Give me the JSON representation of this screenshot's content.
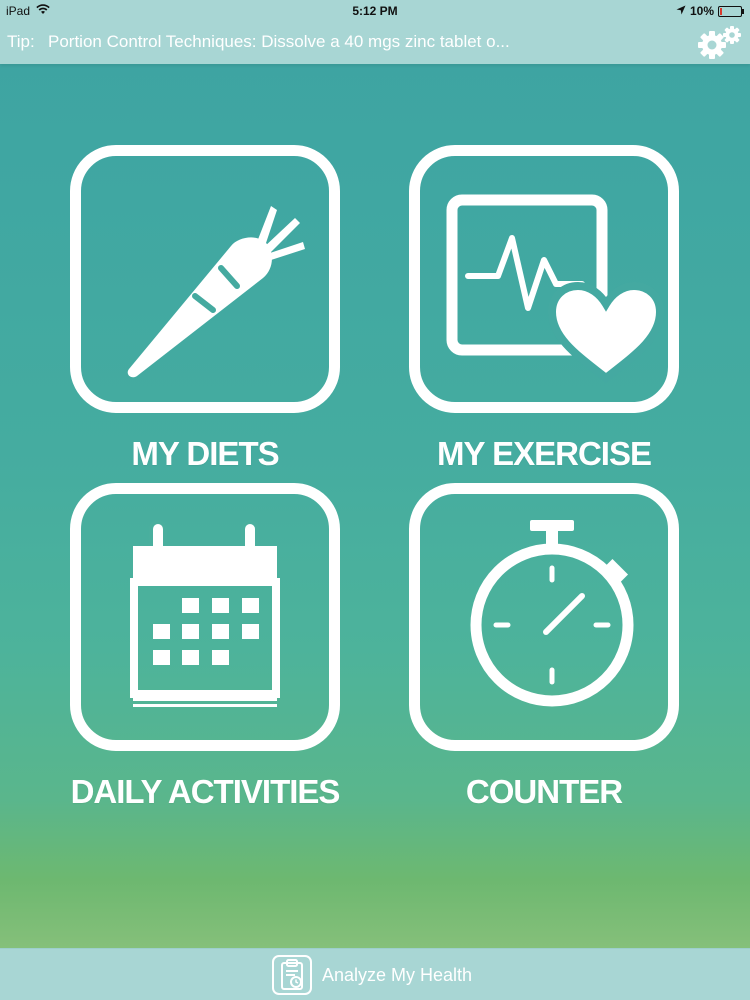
{
  "status_bar": {
    "device": "iPad",
    "time": "5:12 PM",
    "battery": "10%",
    "battery_level": 0.1
  },
  "tip_bar": {
    "label": "Tip:",
    "text": "Portion Control Techniques: Dissolve a 40 mgs zinc tablet o..."
  },
  "tiles": [
    {
      "label": "MY DIETS",
      "icon": "carrot-icon"
    },
    {
      "label": "MY EXERCISE",
      "icon": "heart-monitor-icon"
    },
    {
      "label": "DAILY ACTIVITIES",
      "icon": "calendar-icon"
    },
    {
      "label": "COUNTER",
      "icon": "stopwatch-icon"
    }
  ],
  "bottom_bar": {
    "analyze_label": "Analyze My Health",
    "icon": "clipboard-clock-icon"
  },
  "colors": {
    "bar_background": "#a8d6d4",
    "gradient_top": "#3ea3a3",
    "gradient_bottom": "#9ac99a",
    "battery_low": "#d83a2e"
  }
}
